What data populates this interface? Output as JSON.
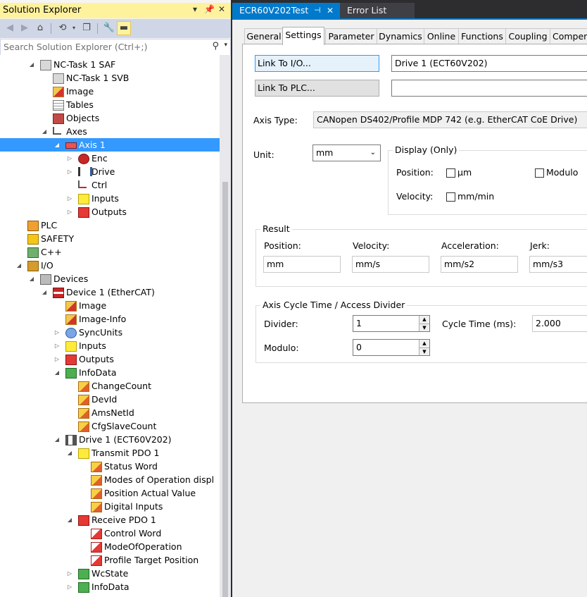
{
  "solution_explorer": {
    "title": "Solution Explorer",
    "controls": {
      "menu": "▾",
      "pin": "📌",
      "close": "✕"
    },
    "search_placeholder": "Search Solution Explorer (Ctrl+;)",
    "tree": [
      {
        "label": "NC-Task 1 SAF",
        "depth": 3,
        "arrow": "down",
        "icon": "i-task",
        "name": "nc-task-saf"
      },
      {
        "label": "NC-Task 1 SVB",
        "depth": 4,
        "arrow": "",
        "icon": "i-task",
        "name": "nc-task-svb"
      },
      {
        "label": "Image",
        "depth": 4,
        "arrow": "",
        "icon": "i-img",
        "name": "image"
      },
      {
        "label": "Tables",
        "depth": 4,
        "arrow": "",
        "icon": "i-table",
        "name": "tables"
      },
      {
        "label": "Objects",
        "depth": 4,
        "arrow": "",
        "icon": "i-obj",
        "name": "objects"
      },
      {
        "label": "Axes",
        "depth": 4,
        "arrow": "down",
        "icon": "i-axes",
        "name": "axes"
      },
      {
        "label": "Axis 1",
        "depth": 5,
        "arrow": "down",
        "icon": "i-axis",
        "name": "axis-1",
        "selected": true
      },
      {
        "label": "Enc",
        "depth": 6,
        "arrow": "right",
        "icon": "i-enc",
        "name": "enc"
      },
      {
        "label": "Drive",
        "depth": 6,
        "arrow": "right",
        "icon": "i-drive",
        "name": "drive"
      },
      {
        "label": "Ctrl",
        "depth": 6,
        "arrow": "",
        "icon": "i-ctrl",
        "name": "ctrl"
      },
      {
        "label": "Inputs",
        "depth": 6,
        "arrow": "right",
        "icon": "i-in",
        "name": "axis-inputs"
      },
      {
        "label": "Outputs",
        "depth": 6,
        "arrow": "right",
        "icon": "i-out",
        "name": "axis-outputs"
      },
      {
        "label": "PLC",
        "depth": 2,
        "arrow": "",
        "icon": "i-plc",
        "name": "plc"
      },
      {
        "label": "SAFETY",
        "depth": 2,
        "arrow": "",
        "icon": "i-safe",
        "name": "safety"
      },
      {
        "label": "C++",
        "depth": 2,
        "arrow": "",
        "icon": "i-cpp",
        "name": "cpp"
      },
      {
        "label": "I/O",
        "depth": 2,
        "arrow": "down",
        "icon": "i-io",
        "name": "io"
      },
      {
        "label": "Devices",
        "depth": 3,
        "arrow": "down",
        "icon": "i-dev",
        "name": "devices"
      },
      {
        "label": "Device 1 (EtherCAT)",
        "depth": 4,
        "arrow": "down",
        "icon": "i-ec",
        "name": "device-1-ethercat"
      },
      {
        "label": "Image",
        "depth": 5,
        "arrow": "",
        "icon": "i-img",
        "name": "device-image"
      },
      {
        "label": "Image-Info",
        "depth": 5,
        "arrow": "",
        "icon": "i-img",
        "name": "image-info"
      },
      {
        "label": "SyncUnits",
        "depth": 5,
        "arrow": "right",
        "icon": "i-sync",
        "name": "syncunits"
      },
      {
        "label": "Inputs",
        "depth": 5,
        "arrow": "right",
        "icon": "i-in",
        "name": "device-inputs"
      },
      {
        "label": "Outputs",
        "depth": 5,
        "arrow": "right",
        "icon": "i-out",
        "name": "device-outputs"
      },
      {
        "label": "InfoData",
        "depth": 5,
        "arrow": "down",
        "icon": "i-green",
        "name": "infodata"
      },
      {
        "label": "ChangeCount",
        "depth": 6,
        "arrow": "",
        "icon": "i-var",
        "name": "changecount"
      },
      {
        "label": "DevId",
        "depth": 6,
        "arrow": "",
        "icon": "i-var",
        "name": "devid"
      },
      {
        "label": "AmsNetId",
        "depth": 6,
        "arrow": "",
        "icon": "i-var",
        "name": "amsnetid"
      },
      {
        "label": "CfgSlaveCount",
        "depth": 6,
        "arrow": "",
        "icon": "i-var",
        "name": "cfgslavecount"
      },
      {
        "label": "Drive 1 (ECT60V202)",
        "depth": 5,
        "arrow": "down",
        "icon": "i-drv",
        "name": "drive-1-ect60v202"
      },
      {
        "label": "Transmit PDO 1",
        "depth": 6,
        "arrow": "down",
        "icon": "i-in",
        "name": "transmit-pdo-1"
      },
      {
        "label": "Status Word",
        "depth": 7,
        "arrow": "",
        "icon": "i-var",
        "name": "status-word"
      },
      {
        "label": "Modes of Operation displ",
        "depth": 7,
        "arrow": "",
        "icon": "i-var",
        "name": "modes-of-operation-display"
      },
      {
        "label": "Position Actual Value",
        "depth": 7,
        "arrow": "",
        "icon": "i-var",
        "name": "position-actual-value"
      },
      {
        "label": "Digital Inputs",
        "depth": 7,
        "arrow": "",
        "icon": "i-var",
        "name": "digital-inputs"
      },
      {
        "label": "Receive PDO 1",
        "depth": 6,
        "arrow": "down",
        "icon": "i-out",
        "name": "receive-pdo-1"
      },
      {
        "label": "Control Word",
        "depth": 7,
        "arrow": "",
        "icon": "i-var2",
        "name": "control-word"
      },
      {
        "label": "ModeOfOperation",
        "depth": 7,
        "arrow": "",
        "icon": "i-var2",
        "name": "modeofoperation"
      },
      {
        "label": "Profile Target Position",
        "depth": 7,
        "arrow": "",
        "icon": "i-var2",
        "name": "profile-target-position"
      },
      {
        "label": "WcState",
        "depth": 6,
        "arrow": "right",
        "icon": "i-green",
        "name": "wcstate"
      },
      {
        "label": "InfoData",
        "depth": 6,
        "arrow": "right",
        "icon": "i-green",
        "name": "drive-infodata"
      }
    ]
  },
  "document_tabs": {
    "active": "ECR60V202Test",
    "pin": "⊣",
    "close": "✕",
    "other": "Error List"
  },
  "property_tabs": [
    "General",
    "Settings",
    "Parameter",
    "Dynamics",
    "Online",
    "Functions",
    "Coupling",
    "Compen"
  ],
  "settings": {
    "link_io_label": "Link To I/O...",
    "link_io_value": "Drive 1 (ECT60V202)",
    "link_plc_label": "Link To PLC...",
    "link_plc_value": "",
    "axis_type_label": "Axis Type:",
    "axis_type_value": "CANopen DS402/Profile MDP 742 (e.g. EtherCAT CoE Drive)",
    "unit_label": "Unit:",
    "unit_value": "mm",
    "display_group": "Display (Only)",
    "position_label": "Position:",
    "position_unit": "µm",
    "modulo_check_label": "Modulo",
    "velocity_label": "Velocity:",
    "velocity_unit": "mm/min",
    "result_group": "Result",
    "result_position_label": "Position:",
    "result_velocity_label": "Velocity:",
    "result_acceleration_label": "Acceleration:",
    "result_jerk_label": "Jerk:",
    "result_position": "mm",
    "result_velocity": "mm/s",
    "result_acceleration": "mm/s2",
    "result_jerk": "mm/s3",
    "cycle_group": "Axis Cycle Time / Access Divider",
    "divider_label": "Divider:",
    "divider_value": "1",
    "cycle_time_label": "Cycle Time (ms):",
    "cycle_time_value": "2.000",
    "modulo_label": "Modulo:",
    "modulo_value": "0"
  },
  "colors": {
    "selection": "#3399ff",
    "title_highlight": "#fff29d",
    "active_tab": "#007acc"
  }
}
